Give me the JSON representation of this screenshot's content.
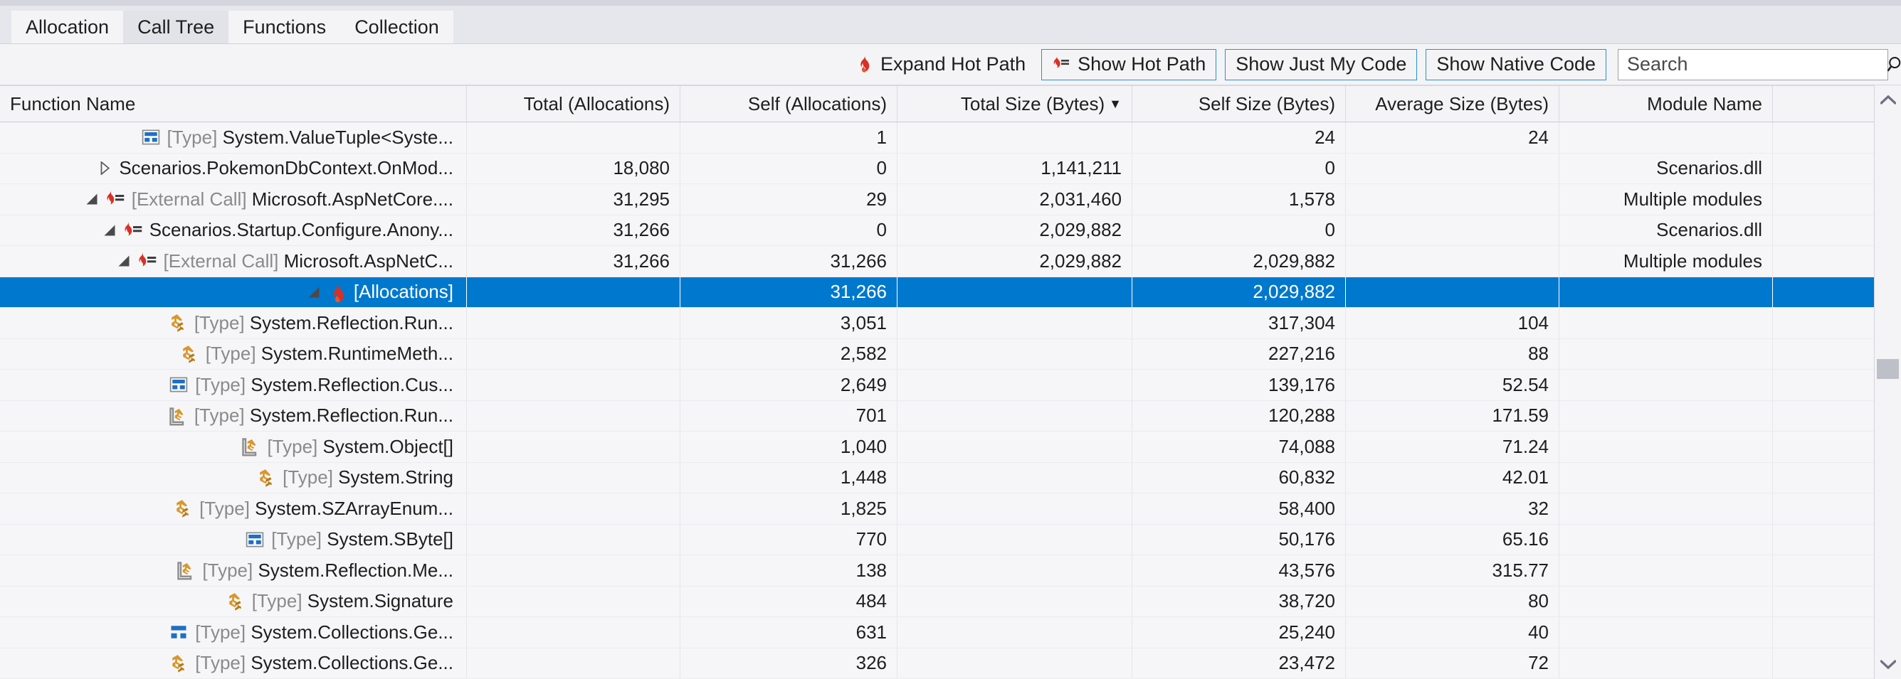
{
  "tabs": [
    {
      "label": "Allocation",
      "selected": false
    },
    {
      "label": "Call Tree",
      "selected": true
    },
    {
      "label": "Functions",
      "selected": false
    },
    {
      "label": "Collection",
      "selected": false
    }
  ],
  "toolbar": {
    "expand_hot_path": "Expand Hot Path",
    "show_hot_path": "Show Hot Path",
    "show_just_my_code": "Show Just My Code",
    "show_native_code": "Show Native Code",
    "search_placeholder": "Search",
    "search_value": ""
  },
  "colors": {
    "selection_blue": "#0078ce",
    "button_border_blue": "#2a8fd4",
    "flame_red": "#d93025",
    "type_orange": "#d9972c",
    "type_blue": "#1f6fc4",
    "header_bg": "#f4f4f6",
    "row_bg": "#f6f6f8"
  },
  "columns": [
    {
      "label": "Function Name",
      "align": "left",
      "sorted": false
    },
    {
      "label": "Total (Allocations)",
      "align": "right",
      "sorted": false
    },
    {
      "label": "Self (Allocations)",
      "align": "right",
      "sorted": false
    },
    {
      "label": "Total Size (Bytes)",
      "align": "right",
      "sorted": true,
      "sort_dir": "desc"
    },
    {
      "label": "Self Size (Bytes)",
      "align": "right",
      "sorted": false
    },
    {
      "label": "Average Size (Bytes)",
      "align": "right",
      "sorted": false
    },
    {
      "label": "Module Name",
      "align": "right",
      "sorted": false
    },
    {
      "label": "",
      "align": "left",
      "sorted": false
    }
  ],
  "rows": [
    {
      "indent": 4,
      "twisty": "none",
      "icon": "type-struct-icon",
      "hot": false,
      "prefix": "[Type] ",
      "name": "System.ValueTuple<Syste...",
      "total_allocations": "",
      "self_allocations": "1",
      "total_size": "",
      "self_size": "24",
      "average_size": "24",
      "module": "",
      "selected": false
    },
    {
      "indent": 3,
      "twisty": "collapsed",
      "icon": "none",
      "hot": false,
      "prefix": "",
      "name": "Scenarios.PokemonDbContext.OnMod...",
      "total_allocations": "18,080",
      "self_allocations": "0",
      "total_size": "1,141,211",
      "self_size": "0",
      "average_size": "",
      "module": "Scenarios.dll",
      "selected": false
    },
    {
      "indent": 3,
      "twisty": "expanded",
      "icon": "hot-path-icon",
      "hot": true,
      "prefix": "[External Call] ",
      "name": "Microsoft.AspNetCore....",
      "total_allocations": "31,295",
      "self_allocations": "29",
      "total_size": "2,031,460",
      "self_size": "1,578",
      "average_size": "",
      "module": "Multiple modules",
      "selected": false
    },
    {
      "indent": 4,
      "twisty": "expanded",
      "icon": "hot-path-icon",
      "hot": true,
      "prefix": "",
      "name": "Scenarios.Startup.Configure.Anony...",
      "total_allocations": "31,266",
      "self_allocations": "0",
      "total_size": "2,029,882",
      "self_size": "0",
      "average_size": "",
      "module": "Scenarios.dll",
      "selected": false
    },
    {
      "indent": 5,
      "twisty": "expanded",
      "icon": "hot-path-icon",
      "hot": true,
      "prefix": "[External Call] ",
      "name": "Microsoft.AspNetC...",
      "total_allocations": "31,266",
      "self_allocations": "31,266",
      "total_size": "2,029,882",
      "self_size": "2,029,882",
      "average_size": "",
      "module": "Multiple modules",
      "selected": false
    },
    {
      "indent": 6,
      "twisty": "expanded",
      "icon": "flame-icon",
      "hot": true,
      "prefix": "",
      "name": "[Allocations]",
      "total_allocations": "",
      "self_allocations": "31,266",
      "total_size": "",
      "self_size": "2,029,882",
      "average_size": "",
      "module": "",
      "selected": true
    },
    {
      "indent": 7,
      "twisty": "none",
      "icon": "type-class-icon",
      "hot": false,
      "prefix": "[Type] ",
      "name": "System.Reflection.Run...",
      "total_allocations": "",
      "self_allocations": "3,051",
      "total_size": "",
      "self_size": "317,304",
      "average_size": "104",
      "module": "",
      "selected": false
    },
    {
      "indent": 7,
      "twisty": "none",
      "icon": "type-class-icon",
      "hot": false,
      "prefix": "[Type] ",
      "name": "System.RuntimeMeth...",
      "total_allocations": "",
      "self_allocations": "2,582",
      "total_size": "",
      "self_size": "227,216",
      "average_size": "88",
      "module": "",
      "selected": false
    },
    {
      "indent": 7,
      "twisty": "none",
      "icon": "type-struct-icon",
      "hot": false,
      "prefix": "[Type] ",
      "name": "System.Reflection.Cus...",
      "total_allocations": "",
      "self_allocations": "2,649",
      "total_size": "",
      "self_size": "139,176",
      "average_size": "52.54",
      "module": "",
      "selected": false
    },
    {
      "indent": 7,
      "twisty": "none",
      "icon": "type-internal-icon",
      "hot": false,
      "prefix": "[Type] ",
      "name": "System.Reflection.Run...",
      "total_allocations": "",
      "self_allocations": "701",
      "total_size": "",
      "self_size": "120,288",
      "average_size": "171.59",
      "module": "",
      "selected": false
    },
    {
      "indent": 7,
      "twisty": "none",
      "icon": "type-internal-icon",
      "hot": false,
      "prefix": "[Type] ",
      "name": "System.Object[]",
      "total_allocations": "",
      "self_allocations": "1,040",
      "total_size": "",
      "self_size": "74,088",
      "average_size": "71.24",
      "module": "",
      "selected": false
    },
    {
      "indent": 7,
      "twisty": "none",
      "icon": "type-class-icon",
      "hot": false,
      "prefix": "[Type] ",
      "name": "System.String",
      "total_allocations": "",
      "self_allocations": "1,448",
      "total_size": "",
      "self_size": "60,832",
      "average_size": "42.01",
      "module": "",
      "selected": false
    },
    {
      "indent": 7,
      "twisty": "none",
      "icon": "type-class-icon",
      "hot": false,
      "prefix": "[Type] ",
      "name": "System.SZArrayEnum...",
      "total_allocations": "",
      "self_allocations": "1,825",
      "total_size": "",
      "self_size": "58,400",
      "average_size": "32",
      "module": "",
      "selected": false
    },
    {
      "indent": 7,
      "twisty": "none",
      "icon": "type-struct-icon",
      "hot": false,
      "prefix": "[Type] ",
      "name": "System.SByte[]",
      "total_allocations": "",
      "self_allocations": "770",
      "total_size": "",
      "self_size": "50,176",
      "average_size": "65.16",
      "module": "",
      "selected": false
    },
    {
      "indent": 7,
      "twisty": "none",
      "icon": "type-internal-icon",
      "hot": false,
      "prefix": "[Type] ",
      "name": "System.Reflection.Me...",
      "total_allocations": "",
      "self_allocations": "138",
      "total_size": "",
      "self_size": "43,576",
      "average_size": "315.77",
      "module": "",
      "selected": false
    },
    {
      "indent": 7,
      "twisty": "none",
      "icon": "type-class-icon",
      "hot": false,
      "prefix": "[Type] ",
      "name": "System.Signature",
      "total_allocations": "",
      "self_allocations": "484",
      "total_size": "",
      "self_size": "38,720",
      "average_size": "80",
      "module": "",
      "selected": false
    },
    {
      "indent": 7,
      "twisty": "none",
      "icon": "type-interface-icon",
      "hot": false,
      "prefix": "[Type] ",
      "name": "System.Collections.Ge...",
      "total_allocations": "",
      "self_allocations": "631",
      "total_size": "",
      "self_size": "25,240",
      "average_size": "40",
      "module": "",
      "selected": false
    },
    {
      "indent": 7,
      "twisty": "none",
      "icon": "type-class-icon",
      "hot": false,
      "prefix": "[Type] ",
      "name": "System.Collections.Ge...",
      "total_allocations": "",
      "self_allocations": "326",
      "total_size": "",
      "self_size": "23,472",
      "average_size": "72",
      "module": "",
      "selected": false
    }
  ],
  "scrollbar": {
    "up_arrow": "chevron-up",
    "down_arrow": "chevron-down"
  }
}
